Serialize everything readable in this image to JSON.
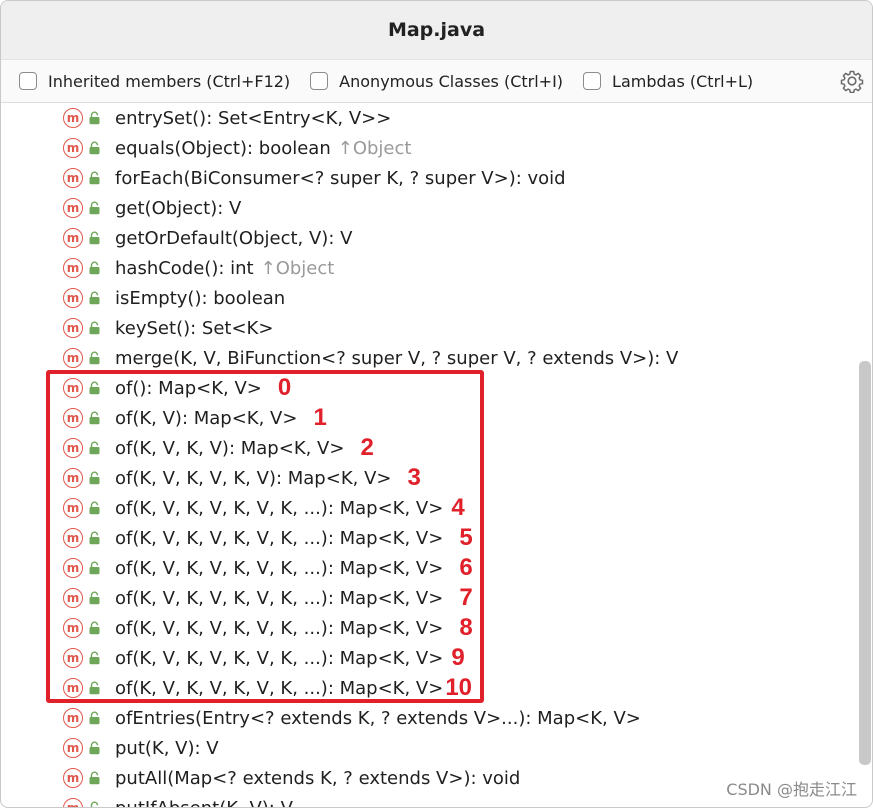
{
  "window": {
    "title": "Map.java"
  },
  "toolbar": {
    "checkboxes": [
      {
        "label": "Inherited members (Ctrl+F12)",
        "checked": false
      },
      {
        "label": "Anonymous Classes (Ctrl+I)",
        "checked": false
      },
      {
        "label": "Lambdas (Ctrl+L)",
        "checked": false
      }
    ],
    "settings_icon": "gear-icon"
  },
  "icons": {
    "method": "m",
    "visibility": "lock-icon"
  },
  "colors": {
    "method_icon": "#e2574c",
    "lock": "#6fa75a",
    "annotation": "#e0202a",
    "inherited": "#9a9a9a"
  },
  "members": [
    {
      "sig": "entrySet(): Set<Entry<K, V>>",
      "inherited": "",
      "annotation": ""
    },
    {
      "sig": "equals(Object): boolean",
      "inherited": "↑Object",
      "annotation": ""
    },
    {
      "sig": "forEach(BiConsumer<? super K, ? super V>): void",
      "inherited": "",
      "annotation": ""
    },
    {
      "sig": "get(Object): V",
      "inherited": "",
      "annotation": ""
    },
    {
      "sig": "getOrDefault(Object, V): V",
      "inherited": "",
      "annotation": ""
    },
    {
      "sig": "hashCode(): int",
      "inherited": "↑Object",
      "annotation": ""
    },
    {
      "sig": "isEmpty(): boolean",
      "inherited": "",
      "annotation": ""
    },
    {
      "sig": "keySet(): Set<K>",
      "inherited": "",
      "annotation": ""
    },
    {
      "sig": "merge(K, V, BiFunction<? super V, ? super V, ? extends V>): V",
      "inherited": "",
      "annotation": ""
    },
    {
      "sig": "of(): Map<K, V>",
      "inherited": "",
      "annotation": "0"
    },
    {
      "sig": "of(K, V): Map<K, V>",
      "inherited": "",
      "annotation": "1"
    },
    {
      "sig": "of(K, V, K, V): Map<K, V>",
      "inherited": "",
      "annotation": "2"
    },
    {
      "sig": "of(K, V, K, V, K, V): Map<K, V>",
      "inherited": "",
      "annotation": "3"
    },
    {
      "sig": "of(K, V, K, V, K, V, K, ...): Map<K, V>",
      "inherited": "",
      "annotation": "4"
    },
    {
      "sig": "of(K, V, K, V, K, V, K, ...): Map<K, V>",
      "inherited": "",
      "annotation": "5"
    },
    {
      "sig": "of(K, V, K, V, K, V, K, ...): Map<K, V>",
      "inherited": "",
      "annotation": "6"
    },
    {
      "sig": "of(K, V, K, V, K, V, K, ...): Map<K, V>",
      "inherited": "",
      "annotation": "7"
    },
    {
      "sig": "of(K, V, K, V, K, V, K, ...): Map<K, V>",
      "inherited": "",
      "annotation": "8"
    },
    {
      "sig": "of(K, V, K, V, K, V, K, ...): Map<K, V>",
      "inherited": "",
      "annotation": "9"
    },
    {
      "sig": "of(K, V, K, V, K, V, K, ...): Map<K, V>",
      "inherited": "",
      "annotation": "10"
    },
    {
      "sig": "ofEntries(Entry<? extends K, ? extends V>...): Map<K, V>",
      "inherited": "",
      "annotation": ""
    },
    {
      "sig": "put(K, V): V",
      "inherited": "",
      "annotation": ""
    },
    {
      "sig": "putAll(Map<? extends K, ? extends V>): void",
      "inherited": "",
      "annotation": ""
    },
    {
      "sig": "putIfAbsent(K, V): V",
      "inherited": "",
      "annotation": ""
    }
  ],
  "watermark": "CSDN @抱走江江"
}
